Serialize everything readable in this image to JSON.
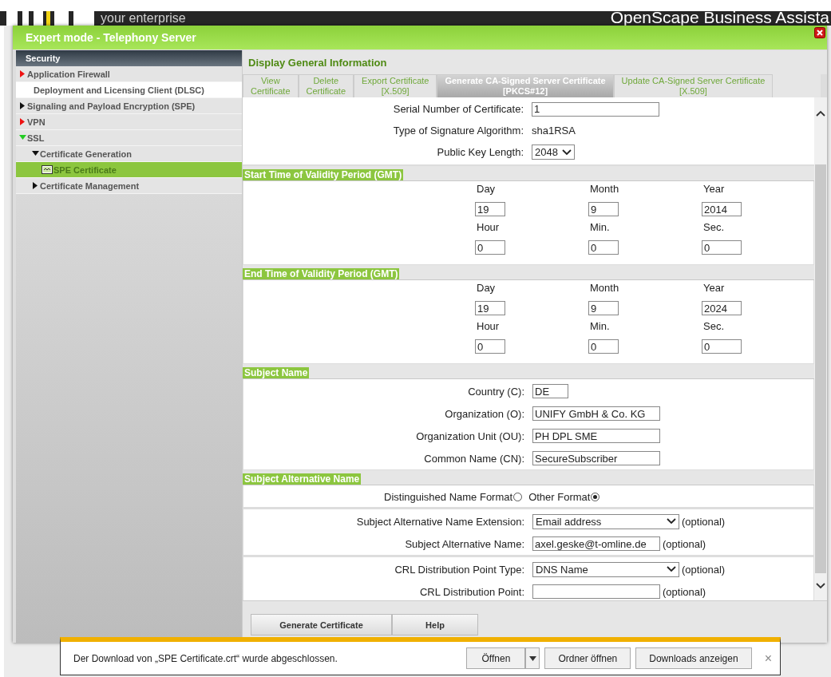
{
  "backdrop": {
    "tagline": "your enterprise",
    "product": "OpenScape Business Assista"
  },
  "dialog": {
    "title": "Expert mode - Telephony Server"
  },
  "sidebar": {
    "title": "Security",
    "items": [
      {
        "kind": "branch",
        "label": "Application Firewall",
        "color": "#ee1111",
        "expanded": false,
        "selected": false
      },
      {
        "kind": "link",
        "label": "Deployment and Licensing Client (DLSC)",
        "selected": false
      },
      {
        "kind": "branch",
        "label": "Signaling and Payload Encryption (SPE)",
        "color": "#111111",
        "expanded": false,
        "selected": false
      },
      {
        "kind": "branch",
        "label": "VPN",
        "color": "#ee1111",
        "expanded": false,
        "selected": false
      },
      {
        "kind": "branch",
        "label": "SSL",
        "color": "#22cc22",
        "expanded": true,
        "selected": false,
        "children": [
          {
            "kind": "branch",
            "label": "Certificate Generation",
            "color": "#111111",
            "expanded": true,
            "selected": false,
            "children": [
              {
                "kind": "page",
                "label": "SPE Certificate",
                "selected": true
              }
            ]
          },
          {
            "kind": "branch",
            "label": "Certificate Management",
            "color": "#111111",
            "expanded": false,
            "selected": false
          }
        ]
      }
    ]
  },
  "content": {
    "heading": "Display General Information",
    "tabs": [
      {
        "label": "View\nCertificate",
        "selected": false
      },
      {
        "label": "Delete\nCertificate",
        "selected": false
      },
      {
        "label": "Export Certificate\n[X.509]",
        "selected": false
      },
      {
        "label": "Generate CA-Signed Server Certificate\n[PKCS#12]",
        "selected": true
      },
      {
        "label": "Update CA-Signed Server Certificate\n[X.509]",
        "selected": false
      }
    ],
    "general": [
      {
        "kind": "input",
        "label": "Serial Number of Certificate:",
        "value": "1"
      },
      {
        "kind": "text",
        "label": "Type of Signature Algorithm:",
        "value": "sha1RSA"
      },
      {
        "kind": "small-select",
        "label": "Public Key Length:",
        "value": "2048"
      }
    ],
    "sections": [
      {
        "kind": "datetime",
        "title": "Start Time of Validity Period (GMT)",
        "fields": [
          {
            "label": "Day",
            "value": "19"
          },
          {
            "label": "Month",
            "value": "9"
          },
          {
            "label": "Year",
            "value": "2014"
          },
          {
            "label": "Hour",
            "value": "0"
          },
          {
            "label": "Min.",
            "value": "0"
          },
          {
            "label": "Sec.",
            "value": "0"
          }
        ]
      },
      {
        "kind": "datetime",
        "title": "End Time of Validity Period (GMT)",
        "fields": [
          {
            "label": "Day",
            "value": "19"
          },
          {
            "label": "Month",
            "value": "9"
          },
          {
            "label": "Year",
            "value": "2024"
          },
          {
            "label": "Hour",
            "value": "0"
          },
          {
            "label": "Min.",
            "value": "0"
          },
          {
            "label": "Sec.",
            "value": "0"
          }
        ]
      },
      {
        "kind": "form",
        "title": "Subject Name",
        "groups": [
          [
            {
              "kind": "short-input",
              "label": "Country (C):",
              "value": "DE"
            },
            {
              "kind": "input",
              "label": "Organization (O):",
              "value": "UNIFY GmbH & Co. KG"
            },
            {
              "kind": "input",
              "label": "Organization Unit (OU):",
              "value": "PH DPL SME"
            },
            {
              "kind": "input",
              "label": "Common Name (CN):",
              "value": "SecureSubscriber"
            }
          ]
        ]
      },
      {
        "kind": "form",
        "title": "Subject Alternative Name",
        "groups": [
          [
            {
              "kind": "radios",
              "options": [
                {
                  "label": "Distinguished Name Format",
                  "selected": false
                },
                {
                  "label": "Other Format",
                  "selected": true
                }
              ]
            }
          ],
          [
            {
              "kind": "select",
              "label": "Subject Alternative Name Extension:",
              "value": "Email address",
              "note": "(optional)"
            },
            {
              "kind": "input",
              "label": "Subject Alternative Name:",
              "value": "axel.geske@t-omline.de",
              "note": "(optional)"
            }
          ]
        ]
      },
      {
        "kind": "form",
        "groups": [
          [
            {
              "kind": "select",
              "label": "CRL Distribution Point Type:",
              "value": "DNS Name",
              "note": "(optional)"
            },
            {
              "kind": "input",
              "label": "CRL Distribution Point:",
              "note": "(optional)"
            }
          ]
        ]
      }
    ],
    "buttons": [
      "Generate Certificate",
      "Help"
    ]
  },
  "download_bar": {
    "message": "Der Download von „SPE Certificate.crt“ wurde abgeschlossen.",
    "buttons": [
      "Öffnen",
      "Ordner öffnen",
      "Downloads anzeigen"
    ],
    "close": "×"
  }
}
